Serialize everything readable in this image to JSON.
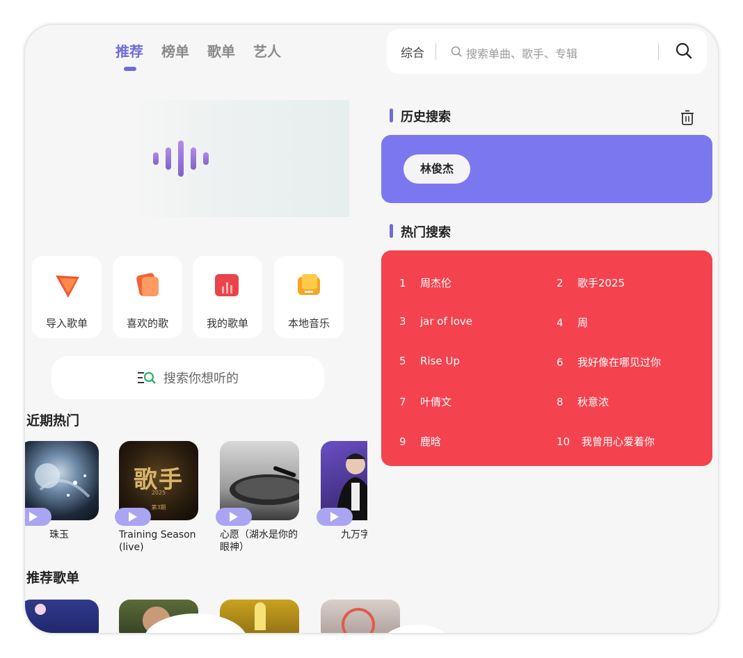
{
  "tabs": [
    "推荐",
    "榜单",
    "歌单",
    "艺人"
  ],
  "quick_actions": [
    "导入歌单",
    "喜欢的歌",
    "我的歌单",
    "本地音乐"
  ],
  "search_prompt": "搜索你想听的",
  "sections": {
    "recent_hot": "近期热门",
    "recommended_playlists": "推荐歌单"
  },
  "songs": [
    {
      "title": "珠玉"
    },
    {
      "title": "Training Season (live)"
    },
    {
      "title": "心愿（湖水是你的眼神）"
    },
    {
      "title": "九万字（"
    }
  ],
  "cover_art_text": {
    "title": "歌手",
    "year": "2025",
    "episode": "第3期"
  },
  "right": {
    "search_category": "综合",
    "search_placeholder": "搜索单曲、歌手、专辑",
    "history_title": "历史搜索",
    "history_items": [
      "林俊杰"
    ],
    "hot_title": "热门搜索",
    "hot_items": [
      {
        "rank": "1",
        "text": "周杰伦"
      },
      {
        "rank": "2",
        "text": "歌手2025"
      },
      {
        "rank": "3",
        "text": "jar of love"
      },
      {
        "rank": "4",
        "text": "周"
      },
      {
        "rank": "5",
        "text": "Rise Up"
      },
      {
        "rank": "6",
        "text": "我好像在哪见过你"
      },
      {
        "rank": "7",
        "text": "叶倩文"
      },
      {
        "rank": "8",
        "text": "秋意浓"
      },
      {
        "rank": "9",
        "text": "鹿晗"
      },
      {
        "rank": "10",
        "text": "我曾用心爱着你"
      }
    ]
  },
  "colors": {
    "accent": "#6f6bd8",
    "history_bg": "#7b78ef",
    "hot_bg": "#f4434f",
    "page_bg": "#f6f6f6"
  },
  "icons": [
    "waveform-icon",
    "search-list-icon",
    "search-icon",
    "trash-icon",
    "play-icon"
  ]
}
